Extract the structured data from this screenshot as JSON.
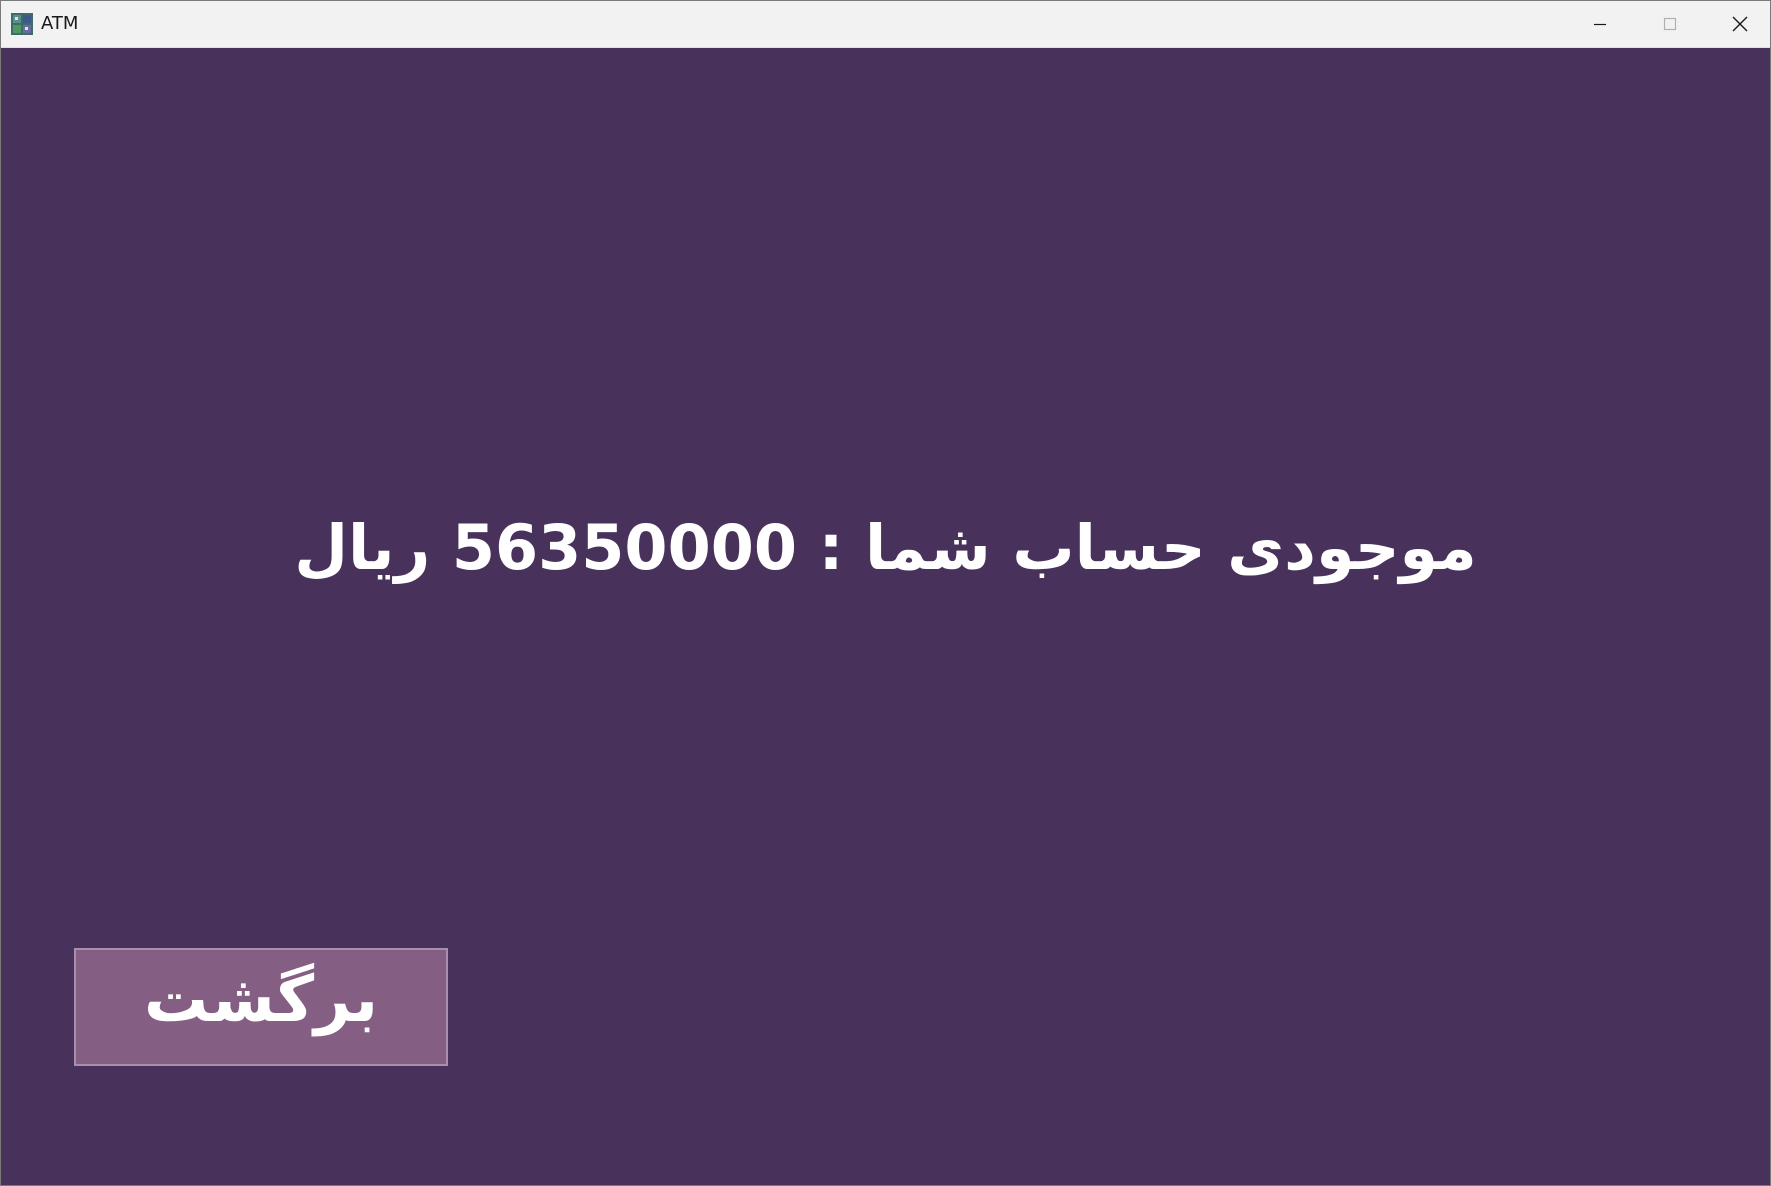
{
  "window": {
    "title": "ATM",
    "app_icon": "atm-app-icon",
    "controls": {
      "minimize_icon": "minimize-icon",
      "maximize_icon": "maximize-icon",
      "close_icon": "close-icon"
    }
  },
  "main": {
    "balance_text": "موجودی حساب شما : 56350000 ریال",
    "back_button_label": "برگشت"
  },
  "colors": {
    "background": "#48325b",
    "button_background": "#845f83",
    "button_border": "#a98fae",
    "text": "#ffffff",
    "titlebar": "#f2f2f2"
  }
}
